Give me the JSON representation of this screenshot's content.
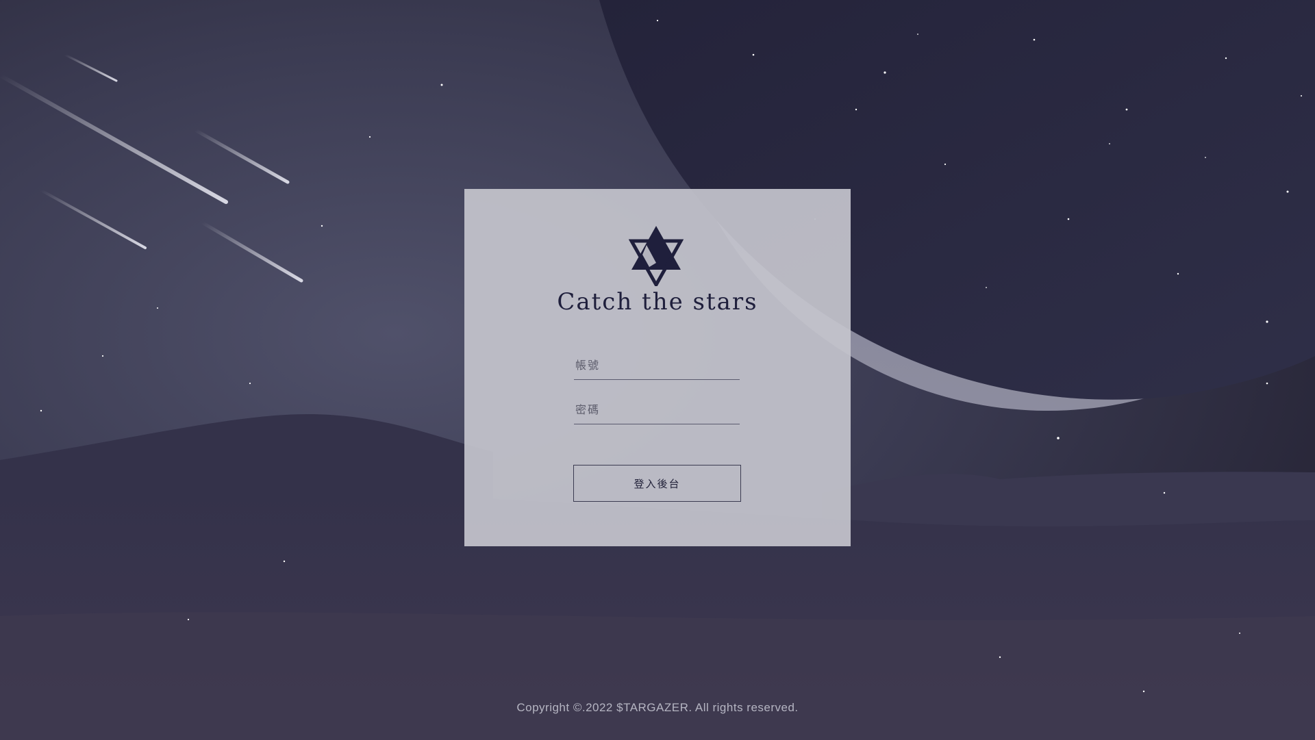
{
  "colors": {
    "sky": "#2a2838",
    "planet": "#8a8a9c",
    "card_bg": "#c4c4cc",
    "logo": "#1f1f3c",
    "button_border": "#3a3a50",
    "copyright_text": "#b5b5c2"
  },
  "login": {
    "logo_icon": "hexagram-star-icon",
    "title": "Catch the stars",
    "account_placeholder": "帳號",
    "password_placeholder": "密碼",
    "submit_label": "登入後台"
  },
  "footer": {
    "copyright": "Copyright ©.2022 $TARGAZER. All rights reserved."
  }
}
